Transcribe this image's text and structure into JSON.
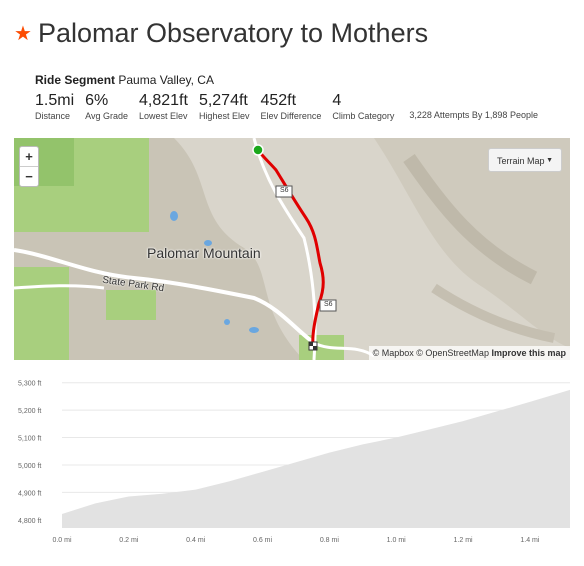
{
  "header": {
    "title": "Palomar Observatory to Mothers"
  },
  "segment": {
    "label": "Ride Segment",
    "location": "Pauma Valley, CA"
  },
  "stats": [
    {
      "value": "1.5mi",
      "label": "Distance"
    },
    {
      "value": "6%",
      "label": "Avg Grade"
    },
    {
      "value": "4,821ft",
      "label": "Lowest Elev"
    },
    {
      "value": "5,274ft",
      "label": "Highest Elev"
    },
    {
      "value": "452ft",
      "label": "Elev Difference"
    },
    {
      "value": "4",
      "label": "Climb Category"
    }
  ],
  "attempts": "3,228 Attempts By 1,898 People",
  "map": {
    "zoom_in": "+",
    "zoom_out": "−",
    "layer_select": "Terrain Map",
    "place_label": "Palomar Mountain",
    "road_label": "State Park Rd",
    "route_shield": "S6",
    "attribution": "© Mapbox © OpenStreetMap",
    "attribution_link": "Improve this map",
    "accent_route": "#e00000",
    "start_color": "#1ba81b"
  },
  "chart_data": {
    "type": "area",
    "title": "",
    "xlabel": "",
    "ylabel": "",
    "x": [
      0.0,
      0.1,
      0.2,
      0.3,
      0.4,
      0.5,
      0.6,
      0.7,
      0.8,
      0.9,
      1.0,
      1.1,
      1.2,
      1.3,
      1.4,
      1.52
    ],
    "y": [
      4821,
      4860,
      4885,
      4895,
      4910,
      4940,
      4975,
      5010,
      5045,
      5075,
      5100,
      5130,
      5160,
      5195,
      5230,
      5274
    ],
    "xlim": [
      0,
      1.52
    ],
    "ylim": [
      4770,
      5310
    ],
    "xticks": [
      "0.0 mi",
      "0.2 mi",
      "0.4 mi",
      "0.6 mi",
      "0.8 mi",
      "1.0 mi",
      "1.2 mi",
      "1.4 mi"
    ],
    "xtick_values": [
      0,
      0.2,
      0.4,
      0.6,
      0.8,
      1.0,
      1.2,
      1.4
    ],
    "yticks": [
      "5,300 ft",
      "5,200 ft",
      "5,100 ft",
      "5,000 ft",
      "4,900 ft",
      "4,800 ft"
    ],
    "ytick_values": [
      5300,
      5200,
      5100,
      5000,
      4900,
      4800
    ],
    "grid": true,
    "fill_color": "#e2e2e2"
  }
}
